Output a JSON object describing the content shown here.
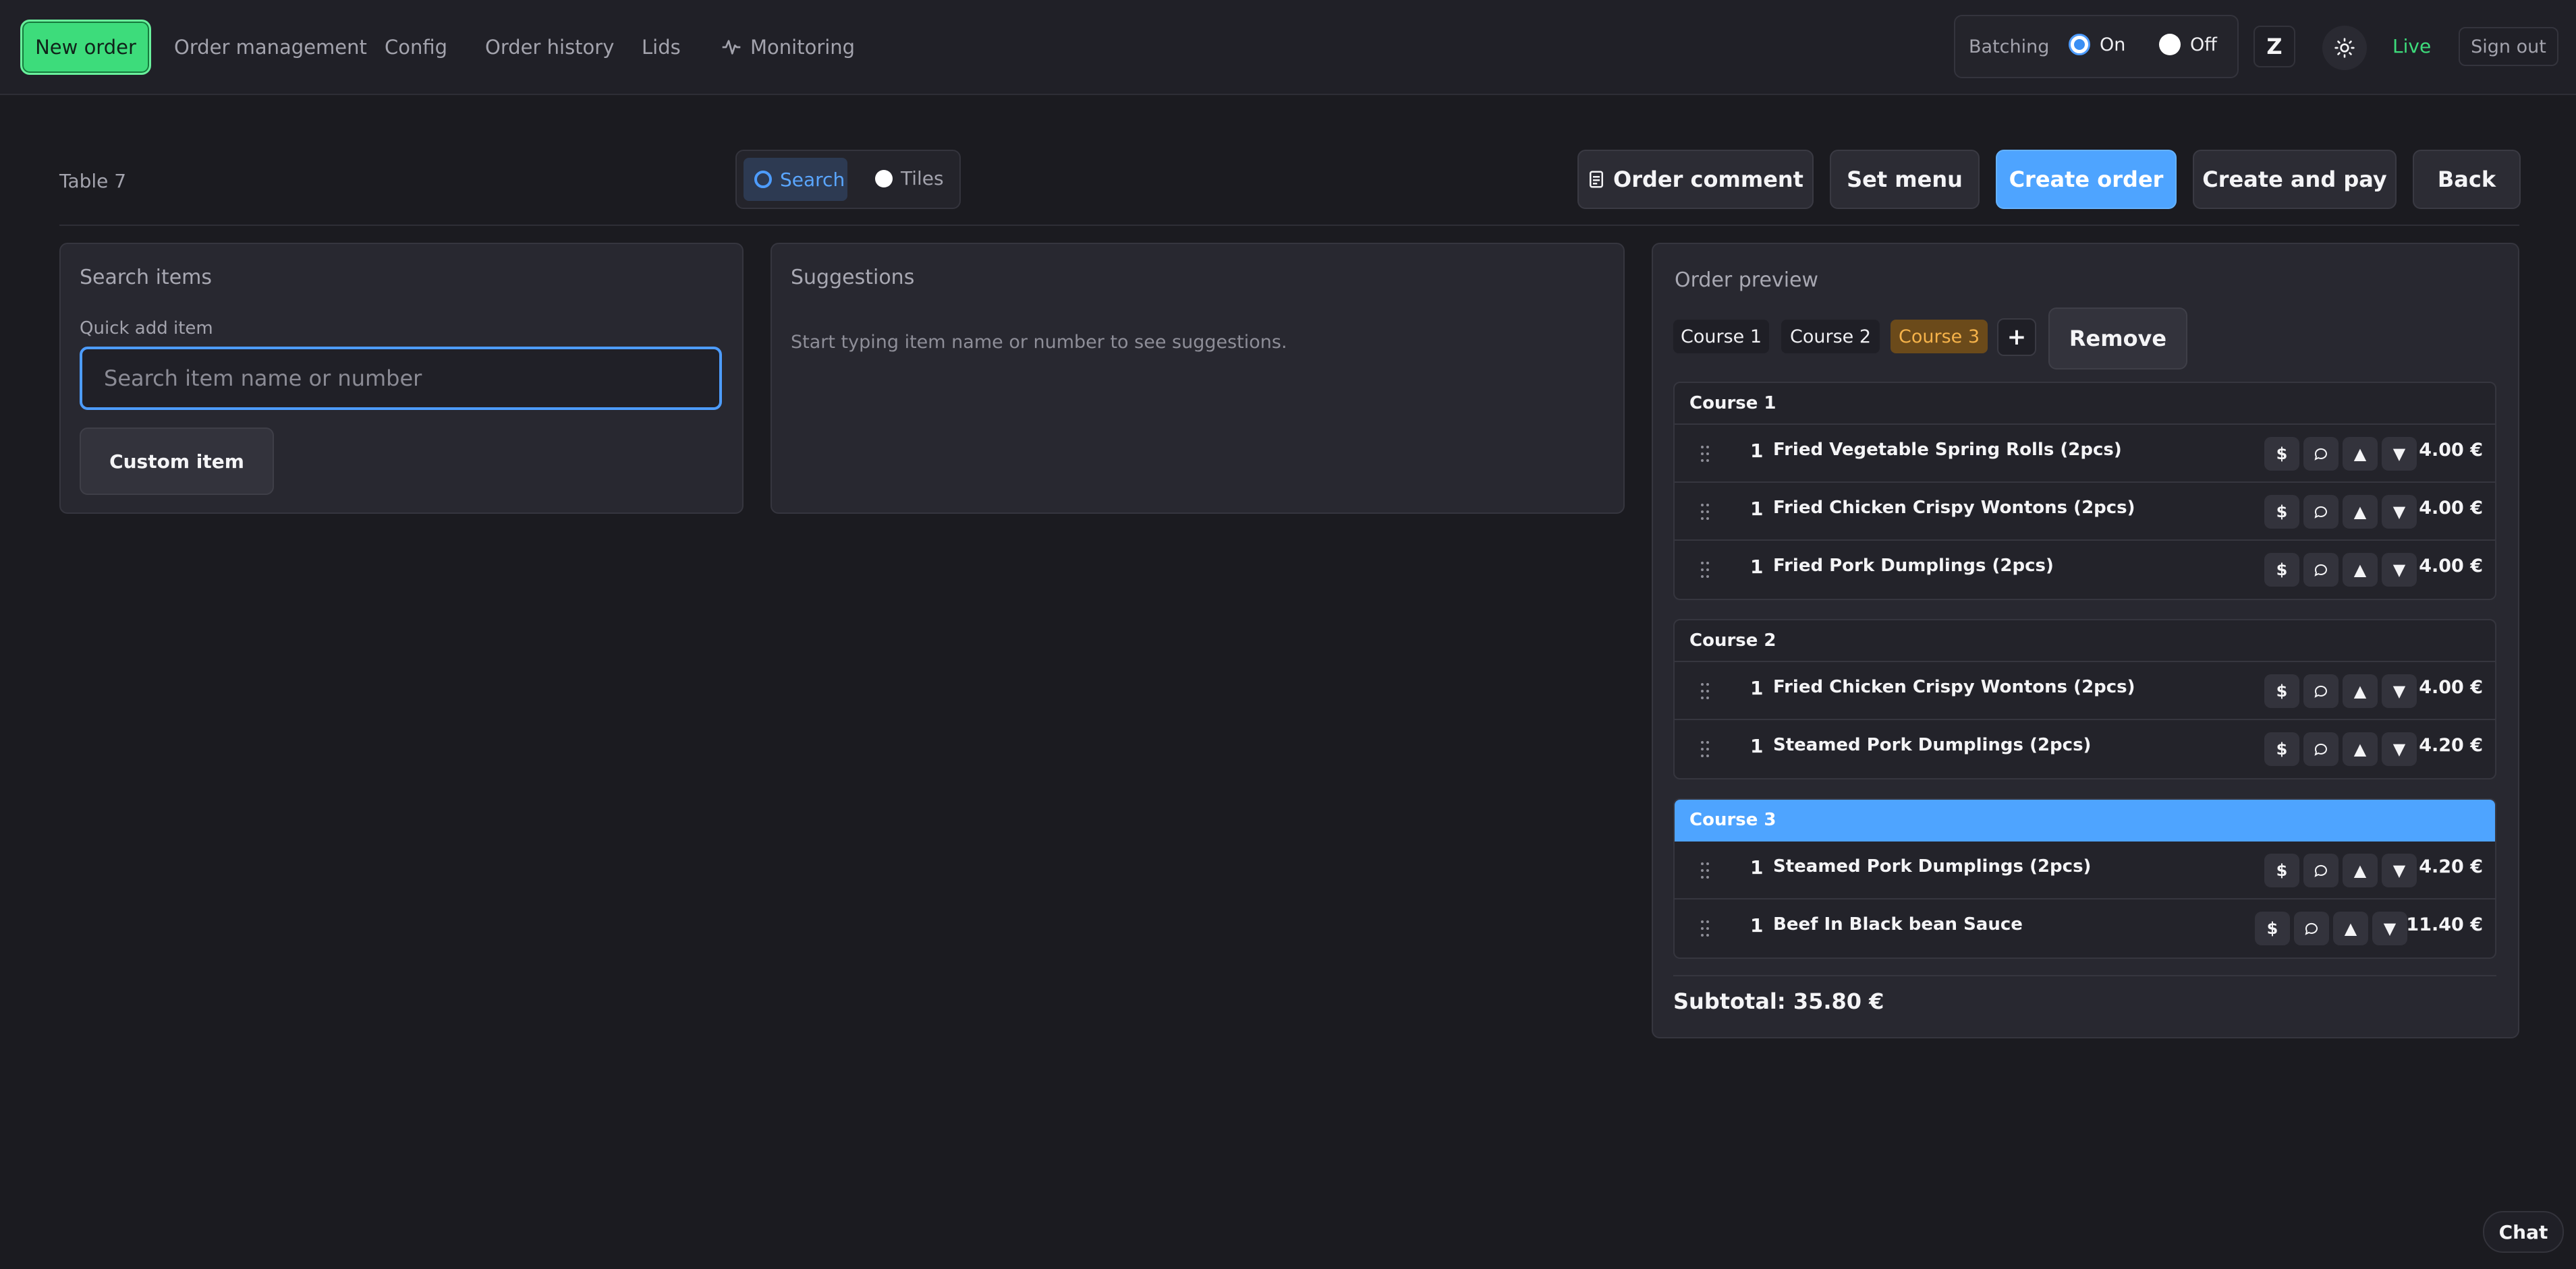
{
  "nav": {
    "items": [
      {
        "label": "New order"
      },
      {
        "label": "Order management"
      },
      {
        "label": "Config"
      },
      {
        "label": "Order history"
      },
      {
        "label": "Lids"
      },
      {
        "label": "Monitoring",
        "icon": "activity-icon"
      }
    ],
    "batching": {
      "label": "Batching",
      "on_label": "On",
      "off_label": "Off",
      "selected": "On"
    },
    "z_label": "Z",
    "theme_icon": "sun-icon",
    "status_label": "Live",
    "signout_label": "Sign out"
  },
  "toolbar": {
    "table_label": "Table 7",
    "mode": {
      "search_label": "Search",
      "tiles_label": "Tiles",
      "selected": "Search"
    },
    "order_comment_label": "Order comment",
    "set_menu_label": "Set menu",
    "create_order_label": "Create order",
    "create_pay_label": "Create and pay",
    "back_label": "Back"
  },
  "search_panel": {
    "title": "Search items",
    "quick_add_label": "Quick add item",
    "placeholder": "Search item name or number",
    "custom_item_label": "Custom item"
  },
  "suggestions_panel": {
    "title": "Suggestions",
    "hint": "Start typing item name or number to see suggestions."
  },
  "order_preview": {
    "title": "Order preview",
    "tabs": [
      "Course 1",
      "Course 2",
      "Course 3"
    ],
    "selected_tab": "Course 3",
    "add_label": "+",
    "remove_label": "Remove",
    "currency": "€",
    "courses": [
      {
        "name": "Course 1",
        "items": [
          {
            "qty": "1",
            "name": "Fried Vegetable Spring Rolls (2pcs)",
            "price": "4.00 €"
          },
          {
            "qty": "1",
            "name": "Fried Chicken Crispy Wontons (2pcs)",
            "price": "4.00 €"
          },
          {
            "qty": "1",
            "name": "Fried Pork Dumplings (2pcs)",
            "price": "4.00 €"
          }
        ]
      },
      {
        "name": "Course 2",
        "items": [
          {
            "qty": "1",
            "name": "Fried Chicken Crispy Wontons (2pcs)",
            "price": "4.00 €"
          },
          {
            "qty": "1",
            "name": "Steamed Pork Dumplings (2pcs)",
            "price": "4.20 €"
          }
        ]
      },
      {
        "name": "Course 3",
        "items": [
          {
            "qty": "1",
            "name": "Steamed Pork Dumplings (2pcs)",
            "price": "4.20 €"
          },
          {
            "qty": "1",
            "name": "Beef In Black bean Sauce",
            "price": "11.40 €"
          }
        ]
      }
    ],
    "row_buttons": {
      "price_label": "$",
      "comment_icon": "comment-icon",
      "up_label": "▲",
      "down_label": "▼"
    },
    "subtotal_label": "Subtotal: 35.80 €"
  },
  "chat_label": "Chat",
  "colors": {
    "accent_blue": "#4ea4ff",
    "accent_green": "#3ddc7b",
    "course_selected": "#f6b34a",
    "background": "#1b1b20"
  }
}
